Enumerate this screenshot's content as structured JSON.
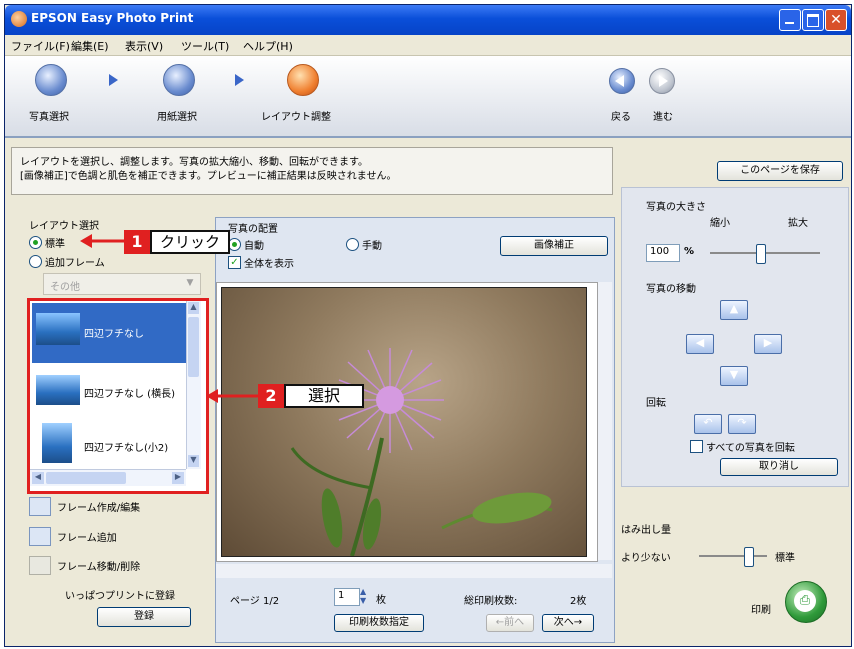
{
  "window": {
    "title": "EPSON Easy Photo Print",
    "menu": [
      "ファイル(F)",
      "編集(E)",
      "表示(V)",
      "ツール(T)",
      "ヘルプ(H)"
    ]
  },
  "toolbar": {
    "steps": [
      {
        "label": "写真選択"
      },
      {
        "label": "用紙選択"
      },
      {
        "label": "レイアウト調整"
      }
    ],
    "back_label": "戻る",
    "forward_label": "進む"
  },
  "info_text": "レイアウトを選択し、調整します。写真の拡大縮小、移動、回転ができます。\n[画像補正]で色調と肌色を補正できます。プレビューに補正結果は反映されません。",
  "save_page_button": "このページを保存",
  "layout": {
    "section_label": "レイアウト選択",
    "option_standard": "標準",
    "option_add_frame": "追加フレーム",
    "frame_select_value": "その他",
    "items": [
      {
        "label": "四辺フチなし"
      },
      {
        "label": "四辺フチなし (横長)"
      },
      {
        "label": "四辺フチなし(小2)"
      }
    ],
    "frame_actions": [
      "フレーム作成/編集",
      "フレーム追加",
      "フレーム移動/削除"
    ],
    "register_label": "いっぱつプリントに登録",
    "register_button": "登録"
  },
  "placement": {
    "title": "写真の配置",
    "auto_label": "自動",
    "manual_label": "手動",
    "image_correction_button": "画像補正",
    "show_all_label": "全体を表示"
  },
  "pager": {
    "page_label": "ページ 1/2",
    "copies_value": "1",
    "copies_unit": "枚",
    "total_label": "総印刷枚数:",
    "total_value": "2枚",
    "copies_setting_button": "印刷枚数指定",
    "prev_button": "←前へ",
    "next_button": "次へ→"
  },
  "right_panel": {
    "size_label": "写真の大きさ",
    "shrink_label": "縮小",
    "enlarge_label": "拡大",
    "size_value": "100",
    "size_unit": "%",
    "size_level": 0.45,
    "move_label": "写真の移動",
    "rotate_label": "回転",
    "rotate_all_label": "すべての写真を回転",
    "cancel_button": "取り消し",
    "overhang_label": "はみ出し量",
    "less_label": "より少ない",
    "standard_label": "標準",
    "overhang_level": 0.75,
    "print_label": "印刷"
  },
  "callouts": [
    {
      "num": "1",
      "text": "クリック"
    },
    {
      "num": "2",
      "text": "選択"
    }
  ],
  "colors": {
    "titlebar": "#0a4fd9",
    "selection": "#316ac5",
    "highlight_border": "#e02020",
    "print_button": "#2f9a3a"
  }
}
